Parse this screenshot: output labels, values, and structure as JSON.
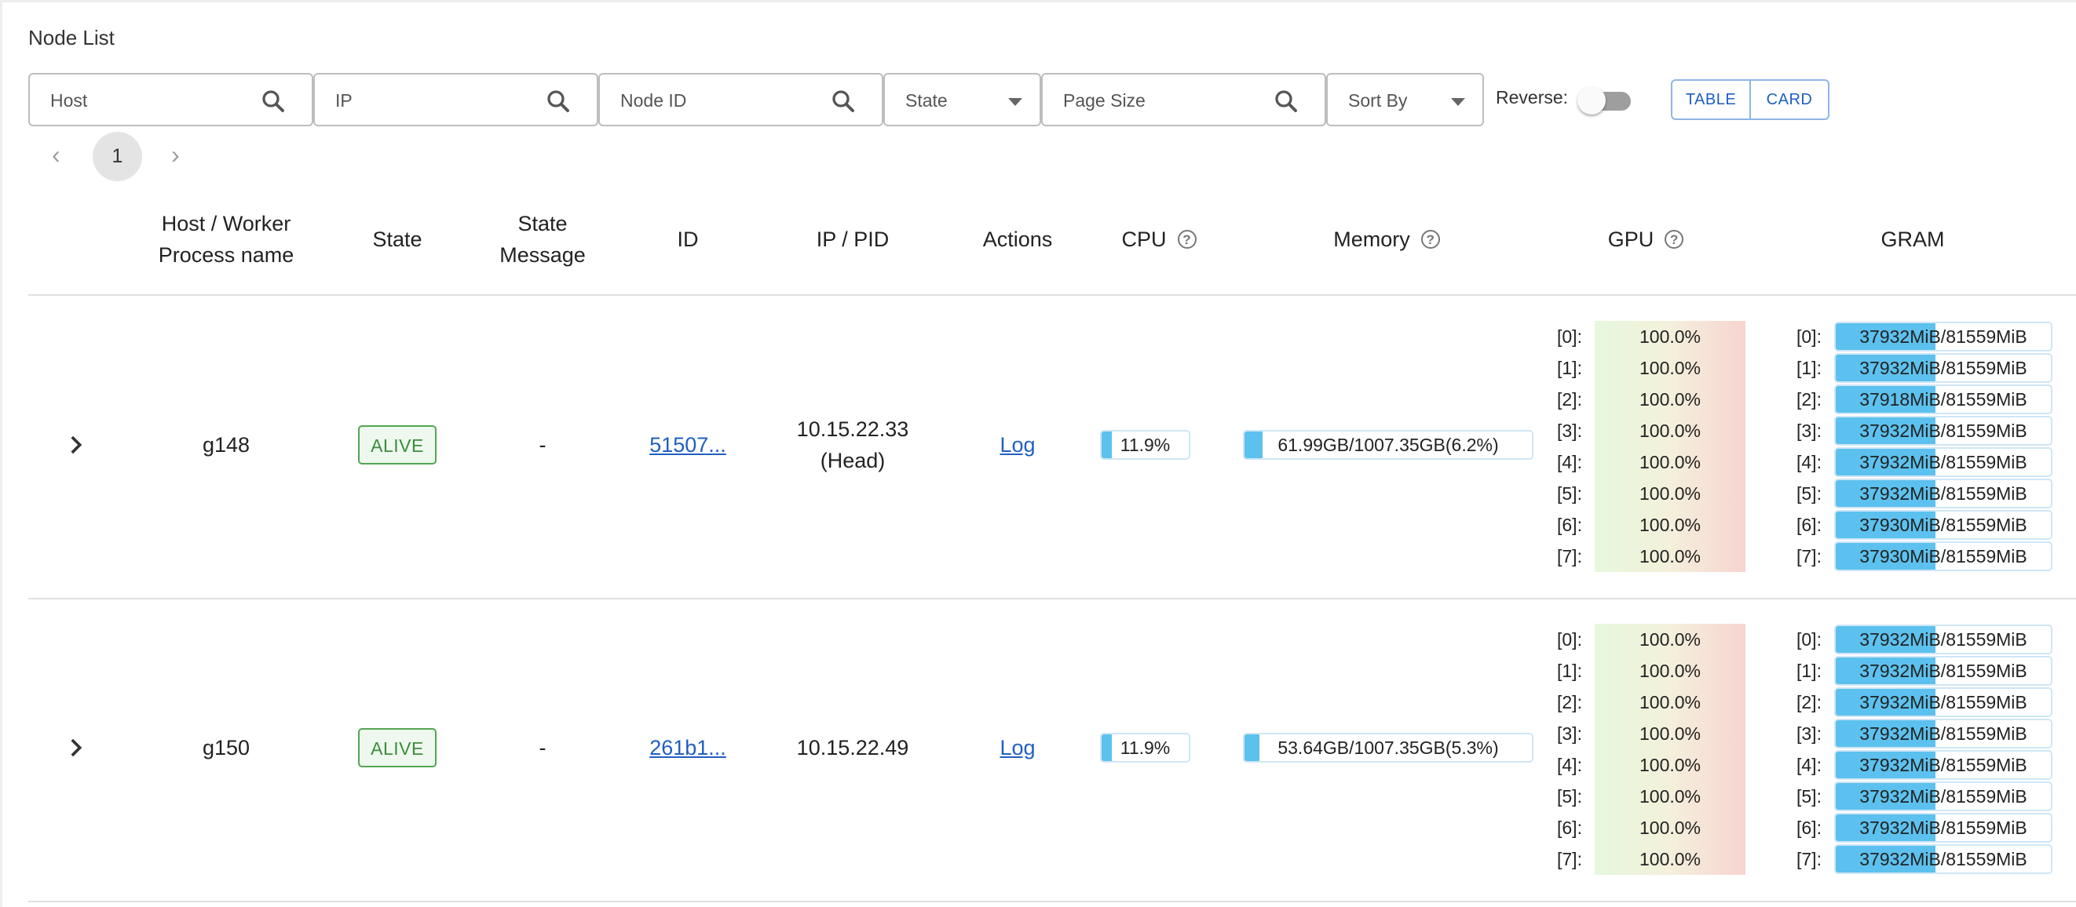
{
  "page": {
    "title": "Node List"
  },
  "filters": {
    "host": {
      "placeholder": "Host"
    },
    "ip": {
      "placeholder": "IP"
    },
    "node_id": {
      "placeholder": "Node ID"
    },
    "state": {
      "label": "State"
    },
    "page_size": {
      "placeholder": "Page Size"
    },
    "sort_by": {
      "label": "Sort By"
    },
    "reverse_label": "Reverse:",
    "reverse_on": false,
    "view_table": "TABLE",
    "view_card": "CARD"
  },
  "pagination": {
    "current": "1",
    "prev": "‹",
    "next": "›"
  },
  "table": {
    "headers": {
      "host_line1": "Host / Worker",
      "host_line2": "Process name",
      "state": "State",
      "state_msg_line1": "State",
      "state_msg_line2": "Message",
      "id": "ID",
      "ip_pid": "IP / PID",
      "actions": "Actions",
      "cpu": "CPU",
      "memory": "Memory",
      "gpu": "GPU",
      "gram": "GRAM"
    },
    "rows": [
      {
        "host": "g148",
        "state": "ALIVE",
        "state_message": "-",
        "id": "51507...",
        "ip_line1": "10.15.22.33",
        "ip_line2": "(Head)",
        "action": "Log",
        "cpu_text": "11.9%",
        "cpu_pct": 11.9,
        "memory_text": "61.99GB/1007.35GB(6.2%)",
        "memory_pct": 6.2,
        "gpu": [
          {
            "idx": "[0]:",
            "util": "100.0%"
          },
          {
            "idx": "[1]:",
            "util": "100.0%"
          },
          {
            "idx": "[2]:",
            "util": "100.0%"
          },
          {
            "idx": "[3]:",
            "util": "100.0%"
          },
          {
            "idx": "[4]:",
            "util": "100.0%"
          },
          {
            "idx": "[5]:",
            "util": "100.0%"
          },
          {
            "idx": "[6]:",
            "util": "100.0%"
          },
          {
            "idx": "[7]:",
            "util": "100.0%"
          }
        ],
        "gram": [
          {
            "idx": "[0]:",
            "text": "37932MiB/81559MiB",
            "pct": 46.5
          },
          {
            "idx": "[1]:",
            "text": "37932MiB/81559MiB",
            "pct": 46.5
          },
          {
            "idx": "[2]:",
            "text": "37918MiB/81559MiB",
            "pct": 46.5
          },
          {
            "idx": "[3]:",
            "text": "37932MiB/81559MiB",
            "pct": 46.5
          },
          {
            "idx": "[4]:",
            "text": "37932MiB/81559MiB",
            "pct": 46.5
          },
          {
            "idx": "[5]:",
            "text": "37932MiB/81559MiB",
            "pct": 46.5
          },
          {
            "idx": "[6]:",
            "text": "37930MiB/81559MiB",
            "pct": 46.5
          },
          {
            "idx": "[7]:",
            "text": "37930MiB/81559MiB",
            "pct": 46.5
          }
        ]
      },
      {
        "host": "g150",
        "state": "ALIVE",
        "state_message": "-",
        "id": "261b1...",
        "ip_line1": "10.15.22.49",
        "ip_line2": "",
        "action": "Log",
        "cpu_text": "11.9%",
        "cpu_pct": 11.9,
        "memory_text": "53.64GB/1007.35GB(5.3%)",
        "memory_pct": 5.3,
        "gpu": [
          {
            "idx": "[0]:",
            "util": "100.0%"
          },
          {
            "idx": "[1]:",
            "util": "100.0%"
          },
          {
            "idx": "[2]:",
            "util": "100.0%"
          },
          {
            "idx": "[3]:",
            "util": "100.0%"
          },
          {
            "idx": "[4]:",
            "util": "100.0%"
          },
          {
            "idx": "[5]:",
            "util": "100.0%"
          },
          {
            "idx": "[6]:",
            "util": "100.0%"
          },
          {
            "idx": "[7]:",
            "util": "100.0%"
          }
        ],
        "gram": [
          {
            "idx": "[0]:",
            "text": "37932MiB/81559MiB",
            "pct": 46.5
          },
          {
            "idx": "[1]:",
            "text": "37932MiB/81559MiB",
            "pct": 46.5
          },
          {
            "idx": "[2]:",
            "text": "37932MiB/81559MiB",
            "pct": 46.5
          },
          {
            "idx": "[3]:",
            "text": "37932MiB/81559MiB",
            "pct": 46.5
          },
          {
            "idx": "[4]:",
            "text": "37932MiB/81559MiB",
            "pct": 46.5
          },
          {
            "idx": "[5]:",
            "text": "37932MiB/81559MiB",
            "pct": 46.5
          },
          {
            "idx": "[6]:",
            "text": "37932MiB/81559MiB",
            "pct": 46.5
          },
          {
            "idx": "[7]:",
            "text": "37932MiB/81559MiB",
            "pct": 46.5
          }
        ]
      }
    ]
  },
  "colors": {
    "link": "#1f5fc2",
    "alive": "#3c8c3c",
    "bar_fill": "#5cc1ee",
    "view_toggle": "#1e5fc1"
  }
}
